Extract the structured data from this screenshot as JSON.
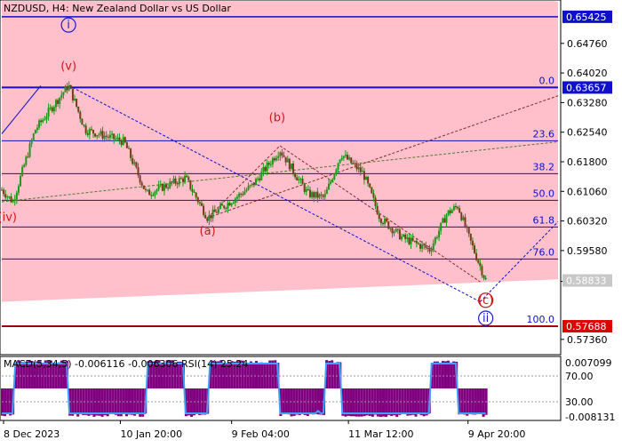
{
  "header": {
    "title": "NZDUSD, H4:  New Zealand Dollar vs US Dollar"
  },
  "colors": {
    "zone_fill": "#ffc0cb",
    "level_line": "#1010c8",
    "wave_label": "#d01818",
    "wave_label_blue": "#1a1acc",
    "candle": "#1a9a1a",
    "candle_body": "#7a3a1a",
    "price_box_blue": "#1010c8",
    "price_box_red": "#dd0000",
    "price_box_gray": "#c8c8c8",
    "macd_hist": "#800080",
    "rsi_line": "#3fa0ff"
  },
  "chart_data": [
    {
      "type": "candlestick",
      "name": "price",
      "y_axis": {
        "min": 0.57,
        "max": 0.658,
        "ticks": [
          "0.64760",
          "0.64020",
          "0.63280",
          "0.62540",
          "0.61800",
          "0.61060",
          "0.60320",
          "0.59580",
          "0.58810",
          "0.57360"
        ]
      },
      "x_axis": {
        "labels": [
          "8 Dec 2023",
          "10 Jan 20:00",
          "9 Feb 04:00",
          "11 Mar 12:00",
          "9 Apr 20:00"
        ]
      },
      "price_boxes": [
        {
          "text": "0.65425",
          "value": 0.65425,
          "style": "blue"
        },
        {
          "text": "0.63657",
          "value": 0.63657,
          "style": "blue"
        },
        {
          "text": "0.58833",
          "value": 0.58833,
          "style": "gray"
        },
        {
          "text": "0.57688",
          "value": 0.57688,
          "style": "red"
        }
      ],
      "fib_levels": [
        {
          "label": "0.0",
          "value": 0.63657
        },
        {
          "label": "23.6",
          "value": 0.62325
        },
        {
          "label": "38.2",
          "value": 0.61502
        },
        {
          "label": "50.0",
          "value": 0.60835
        },
        {
          "label": "61.8",
          "value": 0.6017
        },
        {
          "label": "76.0",
          "value": 0.5937
        },
        {
          "label": "100.0",
          "value": 0.57688
        }
      ],
      "extra_levels": [
        0.65425
      ],
      "wave_labels": [
        {
          "text": "i",
          "t": 0.12,
          "value": 0.6513,
          "circled": true,
          "color": "blue"
        },
        {
          "text": "(v)",
          "t": 0.12,
          "value": 0.641,
          "circled": false,
          "color": "red"
        },
        {
          "text": "(iv)",
          "t": 0.01,
          "value": 0.6032,
          "circled": false,
          "color": "red"
        },
        {
          "text": "(a)",
          "t": 0.37,
          "value": 0.5998,
          "circled": false,
          "color": "red"
        },
        {
          "text": "(b)",
          "t": 0.495,
          "value": 0.6281,
          "circled": false,
          "color": "red"
        },
        {
          "text": "(c)",
          "t": 0.87,
          "value": 0.5825,
          "circled": true,
          "color": "red"
        },
        {
          "text": "ii",
          "t": 0.87,
          "value": 0.578,
          "circled": true,
          "color": "blue"
        }
      ],
      "anchor_points": [
        {
          "t": 0.0,
          "value": 0.611
        },
        {
          "t": 0.02,
          "value": 0.608
        },
        {
          "t": 0.06,
          "value": 0.626
        },
        {
          "t": 0.12,
          "value": 0.6371
        },
        {
          "t": 0.15,
          "value": 0.626
        },
        {
          "t": 0.22,
          "value": 0.623
        },
        {
          "t": 0.26,
          "value": 0.61
        },
        {
          "t": 0.33,
          "value": 0.614
        },
        {
          "t": 0.37,
          "value": 0.604
        },
        {
          "t": 0.45,
          "value": 0.612
        },
        {
          "t": 0.5,
          "value": 0.621
        },
        {
          "t": 0.55,
          "value": 0.61
        },
        {
          "t": 0.58,
          "value": 0.609
        },
        {
          "t": 0.61,
          "value": 0.62
        },
        {
          "t": 0.65,
          "value": 0.615
        },
        {
          "t": 0.68,
          "value": 0.604
        },
        {
          "t": 0.72,
          "value": 0.599
        },
        {
          "t": 0.77,
          "value": 0.596
        },
        {
          "t": 0.8,
          "value": 0.605
        },
        {
          "t": 0.82,
          "value": 0.607
        },
        {
          "t": 0.84,
          "value": 0.599
        },
        {
          "t": 0.87,
          "value": 0.5883
        }
      ]
    },
    {
      "type": "histogram",
      "name": "indicator",
      "legend": "MACD(5,34,5) -0.006116 -0.006306 RSI(14) 25.24",
      "ticks_right": [
        "0.007099",
        "70.00",
        "30.00",
        "-0.008131"
      ]
    }
  ]
}
